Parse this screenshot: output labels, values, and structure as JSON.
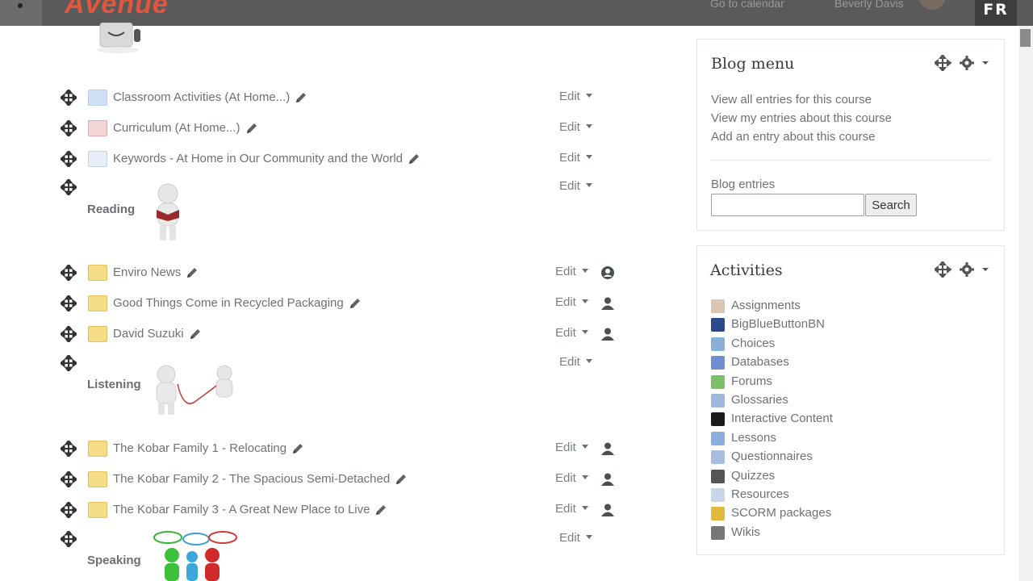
{
  "header": {
    "brand": "Avenue",
    "calendar_link": "Go to calendar",
    "user_name": "Beverly Davis",
    "language": "FR"
  },
  "course": {
    "items": [
      {
        "type": "folder",
        "name": "Classroom Activities (At Home...)",
        "edit": "Edit"
      },
      {
        "type": "pdf",
        "name": "Curriculum (At Home...)",
        "edit": "Edit"
      },
      {
        "type": "doc",
        "name": "Keywords - At Home in Our Community and the World",
        "edit": "Edit"
      }
    ],
    "reading": {
      "label": "Reading",
      "edit": "Edit"
    },
    "reading_items": [
      {
        "name": "Enviro News",
        "edit": "Edit"
      },
      {
        "name": "Good Things Come in Recycled Packaging",
        "edit": "Edit"
      },
      {
        "name": "David Suzuki",
        "edit": "Edit"
      }
    ],
    "listening": {
      "label": "Listening",
      "edit": "Edit"
    },
    "listening_items": [
      {
        "name": "The Kobar Family 1 - Relocating",
        "edit": "Edit"
      },
      {
        "name": "The Kobar Family 2 - The Spacious Semi-Detached",
        "edit": "Edit"
      },
      {
        "name": "The Kobar Family 3 - A Great New Place to Live",
        "edit": "Edit"
      }
    ],
    "speaking": {
      "label": "Speaking",
      "edit": "Edit"
    }
  },
  "blog_menu": {
    "title": "Blog menu",
    "links": [
      "View all entries for this course",
      "View my entries about this course",
      "Add an entry about this course"
    ],
    "entries_label": "Blog entries",
    "search_value": "",
    "search_button": "Search"
  },
  "activities": {
    "title": "Activities",
    "items": [
      {
        "name": "Assignments",
        "icon": "assignment-icon",
        "color": "#d9c7b2"
      },
      {
        "name": "BigBlueButtonBN",
        "icon": "bigbluebutton-icon",
        "color": "#2a4a8a"
      },
      {
        "name": "Choices",
        "icon": "choice-icon",
        "color": "#8ab0d8"
      },
      {
        "name": "Databases",
        "icon": "database-icon",
        "color": "#6f8fd0"
      },
      {
        "name": "Forums",
        "icon": "forum-icon",
        "color": "#7cc06a"
      },
      {
        "name": "Glossaries",
        "icon": "glossary-icon",
        "color": "#9fb7dc"
      },
      {
        "name": "Interactive Content",
        "icon": "h5p-icon",
        "color": "#1a1a1a"
      },
      {
        "name": "Lessons",
        "icon": "lesson-icon",
        "color": "#8aaee0"
      },
      {
        "name": "Questionnaires",
        "icon": "questionnaire-icon",
        "color": "#a9bde0"
      },
      {
        "name": "Quizzes",
        "icon": "quiz-icon",
        "color": "#555555"
      },
      {
        "name": "Resources",
        "icon": "resource-icon",
        "color": "#c8d6ea"
      },
      {
        "name": "SCORM packages",
        "icon": "scorm-icon",
        "color": "#e0b93a"
      },
      {
        "name": "Wikis",
        "icon": "wiki-icon",
        "color": "#777777"
      }
    ]
  }
}
